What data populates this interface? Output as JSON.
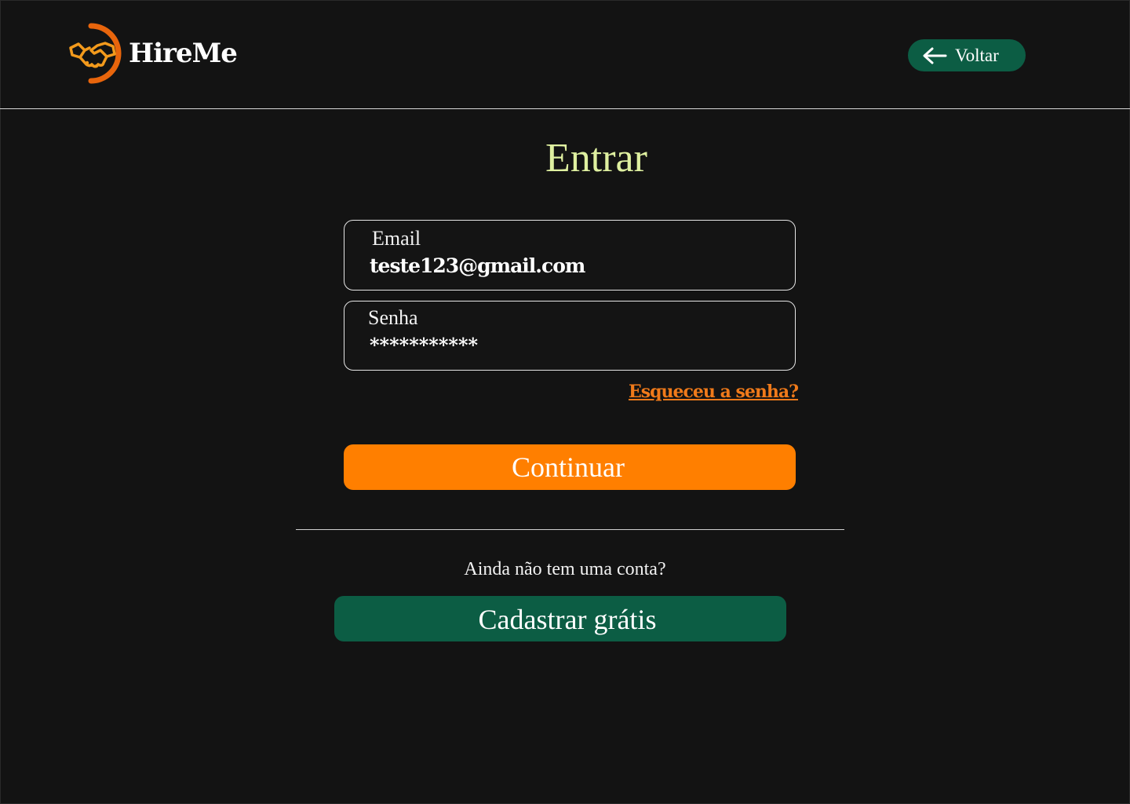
{
  "app": {
    "name": "HireMe",
    "colors": {
      "background": "#131313",
      "accent_orange": "#ff7f00",
      "accent_green": "#0c5d44",
      "title": "#dff0a0",
      "link": "#f07a1a"
    }
  },
  "header": {
    "logo_icon": "handshake-icon",
    "back_button": {
      "icon": "arrow-left-icon",
      "label": "Voltar"
    }
  },
  "login": {
    "title": "Entrar",
    "email": {
      "label": "Email",
      "value": "teste123@gmail.com"
    },
    "password": {
      "label": "Senha",
      "value": "***********"
    },
    "forgot_password": "Esqueceu a senha?",
    "continue_label": "Continuar"
  },
  "signup": {
    "prompt": "Ainda não tem uma conta?",
    "button_label": "Cadastrar grátis"
  }
}
